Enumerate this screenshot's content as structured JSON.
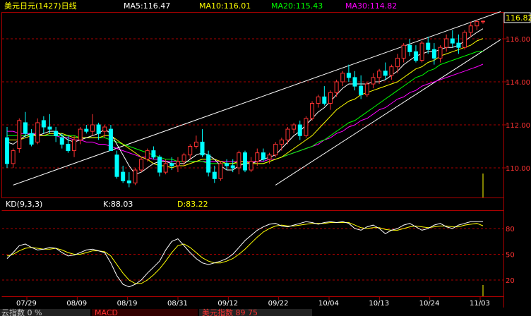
{
  "header": {
    "title": "美元日元(1427)日线",
    "ma5": "MA5:116.47",
    "ma10": "MA10:116.01",
    "ma20": "MA20:115.43",
    "ma30": "MA30:114.82"
  },
  "price_axis": {
    "current": "116.82",
    "ticks": [
      "116.00",
      "114.00",
      "112.00",
      "110.00"
    ]
  },
  "kd_panel": {
    "label": "KD(9,3,3)",
    "k": "K:88.03",
    "d": "D:83.22",
    "ticks": [
      "80",
      "50",
      "20"
    ]
  },
  "x_axis": {
    "labels": [
      "07/29",
      "08/09",
      "08/19",
      "08/31",
      "09/12",
      "09/22",
      "10/04",
      "10/13",
      "10/24",
      "11/03"
    ]
  },
  "bottom_tabs": [
    {
      "label": "云指数  0  %"
    },
    {
      "label": "MACD  "
    },
    {
      "label": "美元指数  89  75"
    }
  ],
  "colors": {
    "bull": "#ff3232",
    "bear": "#00ffff",
    "ma5": "#ffffff",
    "ma10": "#ffff00",
    "ma20": "#00ff00",
    "ma30": "#ff00ff",
    "grid": "#aa0000",
    "axis_text": "#ff3232"
  },
  "chart_data": {
    "type": "candlestick",
    "series_name": "美元日元",
    "ylim": [
      109.0,
      117.0
    ],
    "candles": [
      [
        111.4,
        111.9,
        110.0,
        110.2
      ],
      [
        110.2,
        110.9,
        110.0,
        110.8
      ],
      [
        110.9,
        112.3,
        110.7,
        112.2
      ],
      [
        112.1,
        112.6,
        111.4,
        111.6
      ],
      [
        111.6,
        111.8,
        111.0,
        111.1
      ],
      [
        111.2,
        112.3,
        111.1,
        112.1
      ],
      [
        112.2,
        112.4,
        111.6,
        111.9
      ],
      [
        111.9,
        112.5,
        111.6,
        111.8
      ],
      [
        111.7,
        111.9,
        111.2,
        111.5
      ],
      [
        111.4,
        111.6,
        110.9,
        111.1
      ],
      [
        111.1,
        111.5,
        110.7,
        110.8
      ],
      [
        110.8,
        111.5,
        110.5,
        111.3
      ],
      [
        111.3,
        111.9,
        111.1,
        111.8
      ],
      [
        111.8,
        112.0,
        111.6,
        111.7
      ],
      [
        111.7,
        112.5,
        111.5,
        112.0
      ],
      [
        112.0,
        112.1,
        111.3,
        111.6
      ],
      [
        111.7,
        112.0,
        111.4,
        111.9
      ],
      [
        111.8,
        112.0,
        110.8,
        110.8
      ],
      [
        110.6,
        110.8,
        109.5,
        109.6
      ],
      [
        109.8,
        110.1,
        109.3,
        109.4
      ],
      [
        109.4,
        109.8,
        109.1,
        109.3
      ],
      [
        109.3,
        110.0,
        109.2,
        109.9
      ],
      [
        109.9,
        110.5,
        109.8,
        110.4
      ],
      [
        110.4,
        110.9,
        110.3,
        110.8
      ],
      [
        110.8,
        111.0,
        110.4,
        110.5
      ],
      [
        110.5,
        110.6,
        109.6,
        109.8
      ],
      [
        109.8,
        110.4,
        109.7,
        110.2
      ],
      [
        110.2,
        110.5,
        109.9,
        110.1
      ],
      [
        110.1,
        110.5,
        109.8,
        110.3
      ],
      [
        110.3,
        110.7,
        110.1,
        110.6
      ],
      [
        110.6,
        111.1,
        110.4,
        111.0
      ],
      [
        111.0,
        111.5,
        110.9,
        111.2
      ],
      [
        111.2,
        111.8,
        110.5,
        110.6
      ],
      [
        110.6,
        110.8,
        109.6,
        109.8
      ],
      [
        109.8,
        110.1,
        109.3,
        109.5
      ],
      [
        109.5,
        110.3,
        109.4,
        110.2
      ],
      [
        110.2,
        110.4,
        109.9,
        110.1
      ],
      [
        110.1,
        110.4,
        109.8,
        110.0
      ],
      [
        110.0,
        110.8,
        109.7,
        110.7
      ],
      [
        110.7,
        110.8,
        109.8,
        109.9
      ],
      [
        109.9,
        110.5,
        109.8,
        110.3
      ],
      [
        110.3,
        110.9,
        110.1,
        110.7
      ],
      [
        110.7,
        110.9,
        110.3,
        110.4
      ],
      [
        110.4,
        110.7,
        110.2,
        110.6
      ],
      [
        110.6,
        111.2,
        110.5,
        111.1
      ],
      [
        111.1,
        111.4,
        110.8,
        111.3
      ],
      [
        111.3,
        111.9,
        111.1,
        111.8
      ],
      [
        111.8,
        112.1,
        111.6,
        112.0
      ],
      [
        112.0,
        112.2,
        111.3,
        111.5
      ],
      [
        111.5,
        112.4,
        111.4,
        112.3
      ],
      [
        112.3,
        113.1,
        112.2,
        113.0
      ],
      [
        113.0,
        113.4,
        112.8,
        113.3
      ],
      [
        113.3,
        113.8,
        112.9,
        113.0
      ],
      [
        113.0,
        113.6,
        112.7,
        113.5
      ],
      [
        113.5,
        114.1,
        113.3,
        114.0
      ],
      [
        114.0,
        114.5,
        113.8,
        114.4
      ],
      [
        114.4,
        114.8,
        114.0,
        114.2
      ],
      [
        114.2,
        114.5,
        113.6,
        113.8
      ],
      [
        113.8,
        114.3,
        113.2,
        113.4
      ],
      [
        113.4,
        114.0,
        113.3,
        113.9
      ],
      [
        113.9,
        114.4,
        113.7,
        114.2
      ],
      [
        114.2,
        114.6,
        113.9,
        114.5
      ],
      [
        114.5,
        114.9,
        114.1,
        114.3
      ],
      [
        114.3,
        114.8,
        114.1,
        114.7
      ],
      [
        114.7,
        115.3,
        114.4,
        115.1
      ],
      [
        115.1,
        115.8,
        114.9,
        115.7
      ],
      [
        115.7,
        116.0,
        115.2,
        115.4
      ],
      [
        115.4,
        115.7,
        114.9,
        115.0
      ],
      [
        115.0,
        115.9,
        114.9,
        115.8
      ],
      [
        115.8,
        116.1,
        115.3,
        115.5
      ],
      [
        115.5,
        115.8,
        114.8,
        115.1
      ],
      [
        115.1,
        115.7,
        114.9,
        115.6
      ],
      [
        115.6,
        116.2,
        115.4,
        116.0
      ],
      [
        116.0,
        116.4,
        115.6,
        115.8
      ],
      [
        115.8,
        116.2,
        115.3,
        115.6
      ],
      [
        115.6,
        116.4,
        115.5,
        116.3
      ],
      [
        116.3,
        116.8,
        116.1,
        116.6
      ],
      [
        116.6,
        116.9,
        116.4,
        116.8
      ],
      [
        116.8,
        116.85,
        116.7,
        116.82
      ]
    ],
    "ma5": [
      111.2,
      111.1,
      111.3,
      111.5,
      111.6,
      111.5,
      111.6,
      111.7,
      111.7,
      111.5,
      111.3,
      111.2,
      111.3,
      111.4,
      111.5,
      111.6,
      111.8,
      111.6,
      111.1,
      110.6,
      110.1,
      109.7,
      109.8,
      110.0,
      110.2,
      110.3,
      110.3,
      110.2,
      110.2,
      110.2,
      110.4,
      110.6,
      110.7,
      110.6,
      110.4,
      110.1,
      109.9,
      109.9,
      110.1,
      110.2,
      110.2,
      110.3,
      110.4,
      110.5,
      110.6,
      110.9,
      111.2,
      111.5,
      111.7,
      112.0,
      112.3,
      112.6,
      112.8,
      113.1,
      113.4,
      113.7,
      113.9,
      113.9,
      113.9,
      113.9,
      114.0,
      114.0,
      114.1,
      114.3,
      114.5,
      114.8,
      115.0,
      115.2,
      115.3,
      115.4,
      115.4,
      115.5,
      115.6,
      115.6,
      115.7,
      115.9,
      116.1,
      116.3,
      116.47
    ],
    "ma10": [
      111.3,
      111.3,
      111.3,
      111.4,
      111.5,
      111.5,
      111.5,
      111.6,
      111.6,
      111.6,
      111.5,
      111.4,
      111.4,
      111.4,
      111.4,
      111.4,
      111.5,
      111.5,
      111.3,
      111.1,
      110.9,
      110.7,
      110.5,
      110.4,
      110.2,
      110.1,
      110.1,
      110.0,
      110.1,
      110.1,
      110.2,
      110.3,
      110.4,
      110.4,
      110.4,
      110.3,
      110.2,
      110.2,
      110.3,
      110.3,
      110.2,
      110.2,
      110.2,
      110.3,
      110.4,
      110.5,
      110.7,
      110.9,
      111.1,
      111.3,
      111.5,
      111.8,
      112.1,
      112.4,
      112.7,
      112.9,
      113.1,
      113.2,
      113.4,
      113.5,
      113.6,
      113.7,
      113.8,
      113.9,
      114.0,
      114.2,
      114.4,
      114.6,
      114.7,
      114.9,
      115.0,
      115.2,
      115.3,
      115.4,
      115.5,
      115.6,
      115.7,
      115.9,
      116.01
    ],
    "ma20": [
      111.5,
      111.5,
      111.5,
      111.5,
      111.5,
      111.5,
      111.5,
      111.5,
      111.5,
      111.5,
      111.5,
      111.5,
      111.4,
      111.4,
      111.4,
      111.4,
      111.4,
      111.3,
      111.2,
      111.1,
      111.0,
      110.9,
      110.8,
      110.7,
      110.6,
      110.5,
      110.4,
      110.4,
      110.3,
      110.3,
      110.3,
      110.3,
      110.3,
      110.2,
      110.2,
      110.2,
      110.2,
      110.2,
      110.2,
      110.2,
      110.2,
      110.2,
      110.2,
      110.3,
      110.4,
      110.5,
      110.6,
      110.7,
      110.8,
      110.9,
      111.0,
      111.2,
      111.3,
      111.5,
      111.7,
      111.9,
      112.1,
      112.2,
      112.4,
      112.6,
      112.8,
      113.0,
      113.2,
      113.4,
      113.6,
      113.8,
      114.0,
      114.2,
      114.3,
      114.5,
      114.6,
      114.8,
      114.9,
      115.0,
      115.1,
      115.2,
      115.3,
      115.4,
      115.43
    ],
    "ma30": [
      111.7,
      111.7,
      111.6,
      111.6,
      111.6,
      111.6,
      111.5,
      111.5,
      111.5,
      111.4,
      111.4,
      111.3,
      111.3,
      111.2,
      111.2,
      111.1,
      111.1,
      111.0,
      110.9,
      110.8,
      110.7,
      110.6,
      110.5,
      110.5,
      110.4,
      110.4,
      110.3,
      110.3,
      110.3,
      110.3,
      110.3,
      110.3,
      110.3,
      110.3,
      110.3,
      110.3,
      110.3,
      110.3,
      110.3,
      110.3,
      110.3,
      110.3,
      110.3,
      110.4,
      110.4,
      110.5,
      110.6,
      110.7,
      110.8,
      110.9,
      111.0,
      111.1,
      111.3,
      111.4,
      111.6,
      111.7,
      111.9,
      112.0,
      112.2,
      112.3,
      112.5,
      112.7,
      112.8,
      113.0,
      113.2,
      113.3,
      113.5,
      113.6,
      113.8,
      113.9,
      114.0,
      114.1,
      114.2,
      114.3,
      114.4,
      114.5,
      114.6,
      114.7,
      114.82
    ],
    "k": [
      45,
      52,
      60,
      62,
      58,
      55,
      56,
      58,
      57,
      52,
      48,
      49,
      52,
      55,
      56,
      54,
      52,
      40,
      25,
      15,
      12,
      15,
      20,
      28,
      35,
      42,
      55,
      65,
      68,
      60,
      52,
      45,
      40,
      38,
      40,
      42,
      45,
      50,
      58,
      66,
      72,
      78,
      82,
      85,
      86,
      83,
      82,
      84,
      86,
      88,
      87,
      85,
      87,
      88,
      87,
      88,
      86,
      80,
      78,
      82,
      84,
      80,
      74,
      78,
      80,
      84,
      86,
      82,
      78,
      80,
      84,
      86,
      82,
      80,
      84,
      86,
      88,
      88,
      88.03
    ],
    "d": [
      48,
      50,
      54,
      57,
      58,
      57,
      56,
      56,
      57,
      55,
      52,
      50,
      50,
      52,
      54,
      54,
      53,
      48,
      38,
      28,
      20,
      16,
      16,
      20,
      26,
      33,
      42,
      52,
      60,
      62,
      58,
      52,
      46,
      42,
      40,
      40,
      42,
      45,
      50,
      56,
      63,
      70,
      76,
      80,
      83,
      84,
      83,
      83,
      84,
      85,
      86,
      86,
      86,
      87,
      87,
      87,
      87,
      84,
      81,
      80,
      81,
      81,
      79,
      78,
      78,
      80,
      82,
      83,
      82,
      81,
      82,
      83,
      83,
      82,
      82,
      84,
      85,
      86,
      83.22
    ],
    "trendlines": [
      {
        "name": "upper-channel",
        "from": [
          1,
          109.2
        ],
        "to": [
          78,
          117.0
        ]
      },
      {
        "name": "lower-channel",
        "from": [
          44,
          109.2
        ],
        "to": [
          78,
          115.7
        ]
      }
    ],
    "volume_spike_at": 78
  }
}
